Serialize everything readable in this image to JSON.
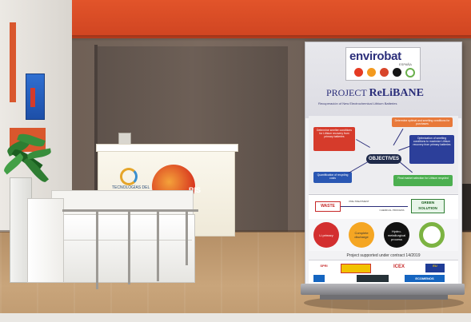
{
  "scene": {
    "kind": "exhibition booth photo",
    "colors": {
      "ceiling": "#e2542a",
      "back_wall": "#6e5f55",
      "floor": "#c9a57b",
      "banner_background": "#f2f2f4",
      "banner_navy": "#2b2e7a"
    }
  },
  "banner": {
    "brand": "envirobat",
    "brand_sub": "ESPAÑA",
    "title_prefix": "PROJECT",
    "title_main": "ReLiBANE",
    "subtitle": "Recuperación of New Electrochemical Lithium Batteries",
    "goal_top": "Determine optimal and smelting conditions for purchases",
    "goal_left": "Determine smelter conditions for Lithium recovery from primary batteries",
    "goal_right": "Optimization of smelting conditions to maximize Lithium recovery from primary batteries",
    "objectives_label": "OBJECTIVES",
    "goal_bottom_left": "Quantification of recycling costs",
    "goal_bottom_right": "Final market selection for Lithium recycled",
    "flow_start": "WASTE",
    "flow_step1": "PRE-TREATMENT",
    "flow_step2": "CHEMICAL PROCESS",
    "flow_end": "GREEN SOLUTION",
    "circle1": "Li primary",
    "circle2": "Complete discharge",
    "circle3": "Hydro-metallurgical process",
    "contract": "Project supported under contract 14/2019",
    "sponsor1": "SPRI",
    "sponsor2": "",
    "sponsor3": "ICEX",
    "sponsor4": "EU",
    "sponsor5": "ECOMENOS"
  },
  "desk": {
    "brand_text": "TECNOLOGÍAS DEL COMBUSTIBLE",
    "circle_text": "RIS"
  }
}
